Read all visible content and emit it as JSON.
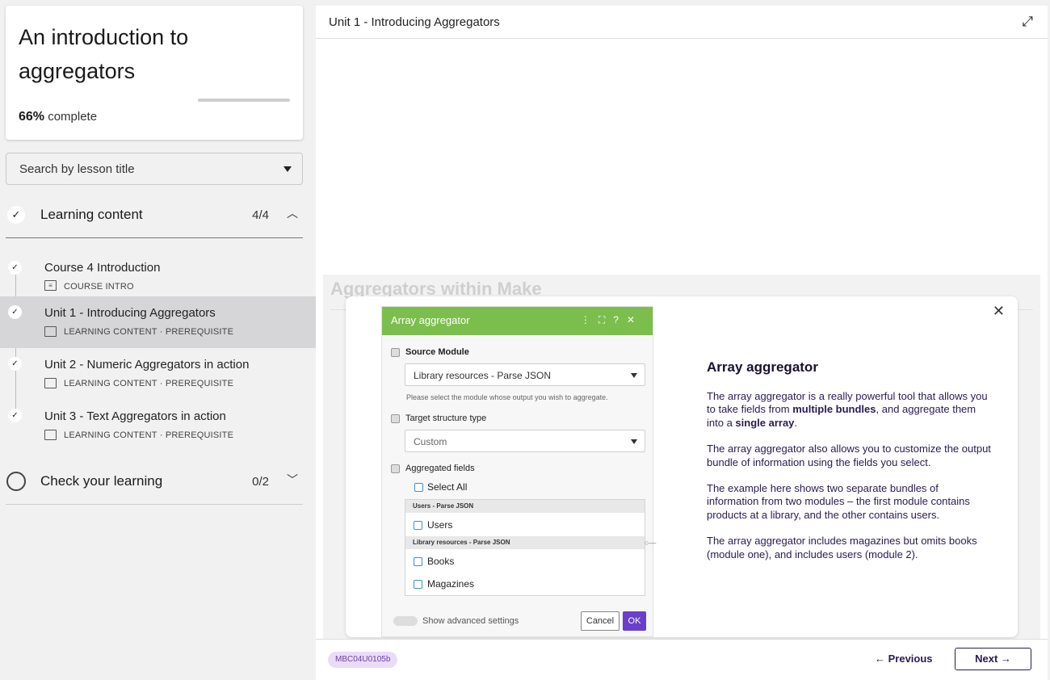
{
  "course": {
    "title": "An introduction to aggregators",
    "progress_percent": "66%",
    "progress_suffix": "complete",
    "progress_value": 0.66
  },
  "search": {
    "placeholder": "Search by lesson title"
  },
  "sections": [
    {
      "label": "Learning content",
      "count": "4/4",
      "completed": true,
      "expanded": true
    },
    {
      "label": "Check your learning",
      "count": "0/2",
      "completed": false,
      "expanded": false
    }
  ],
  "lessons": [
    {
      "title": "Course 4 Introduction",
      "meta": "COURSE INTRO",
      "icon": "document-icon"
    },
    {
      "title": "Unit 1 - Introducing Aggregators",
      "meta": "LEARNING CONTENT · PREREQUISITE",
      "icon": "slides-icon",
      "active": true
    },
    {
      "title": "Unit 2 - Numeric Aggregators in action",
      "meta": "LEARNING CONTENT · PREREQUISITE",
      "icon": "slides-icon"
    },
    {
      "title": "Unit 3 - Text Aggregators in action",
      "meta": "LEARNING CONTENT · PREREQUISITE",
      "icon": "slides-icon"
    }
  ],
  "main": {
    "unit_title": "Unit 1 - Introducing Aggregators",
    "stage_heading": "Aggregators within Make"
  },
  "panel": {
    "title": "Array aggregator",
    "source_label": "Source Module",
    "source_value": "Library resources - Parse JSON",
    "source_hint": "Please select the module whose output you wish to aggregate.",
    "target_label": "Target structure type",
    "target_value": "Custom",
    "fields_label": "Aggregated fields",
    "select_all": "Select All",
    "group1": "Users - Parse JSON",
    "field_users": "Users",
    "group2": "Library resources - Parse JSON",
    "field_books": "Books",
    "field_magazines": "Magazines",
    "advanced": "Show advanced settings",
    "cancel": "Cancel",
    "ok": "OK"
  },
  "info": {
    "heading": "Array aggregator",
    "p1_a": "The array aggregator is a really powerful tool that allows you to take fields from ",
    "p1_b": "multiple bundles",
    "p1_c": ", and aggregate them into a ",
    "p1_d": "single array",
    "p1_e": ".",
    "p2": "The array aggregator also allows you to customize the output bundle of information using the fields you select.",
    "p3": "The example here shows two separate bundles of information from two modules – the first module contains products at a library, and the other contains users.",
    "p4": "The array aggregator includes magazines but omits books (module one), and includes users (module 2)."
  },
  "footer": {
    "code": "MBC04U0105b",
    "previous": "← Previous",
    "next": "Next →"
  },
  "colors": {
    "accent": "#2a1a52",
    "panel_green": "#7cbe4d",
    "ok_purple": "#6a3fcb",
    "tag_bg": "#eadcf8"
  }
}
